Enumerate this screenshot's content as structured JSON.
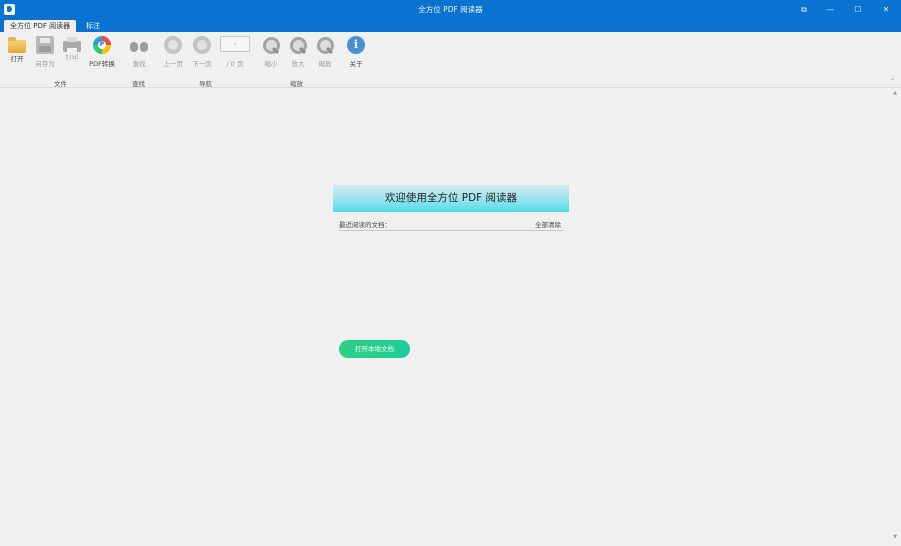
{
  "window": {
    "title": "全方位 PDF 阅读器",
    "controls": [
      "⧉",
      "—",
      "☐",
      "✕"
    ]
  },
  "tabs": [
    {
      "label": "全方位 PDF 阅读器",
      "active": true
    },
    {
      "label": "标注",
      "active": false
    }
  ],
  "toolbar": {
    "open": "打开",
    "save_as": "另存为",
    "print": "打印",
    "pdf_convert": "PDF转换",
    "find": "查找",
    "prev_page": "上一页",
    "next_page": "下一页",
    "page_input_value": "‹",
    "page_count": "/ 0 页",
    "zoom_out": "缩小",
    "zoom_in": "放大",
    "zoom": "缩放",
    "about": "关于"
  },
  "groups": {
    "file": "文件",
    "find": "查找",
    "navigate": "导航",
    "zoom": "缩放"
  },
  "welcome": {
    "banner": "欢迎使用全方位 PDF 阅读器",
    "recent_label": "最近阅读的文档：",
    "clear_all": "全部清除",
    "open_local_button": "打开本地文档"
  },
  "colors": {
    "titlebar": "#0a72d1",
    "open_button": "#2dd184"
  }
}
